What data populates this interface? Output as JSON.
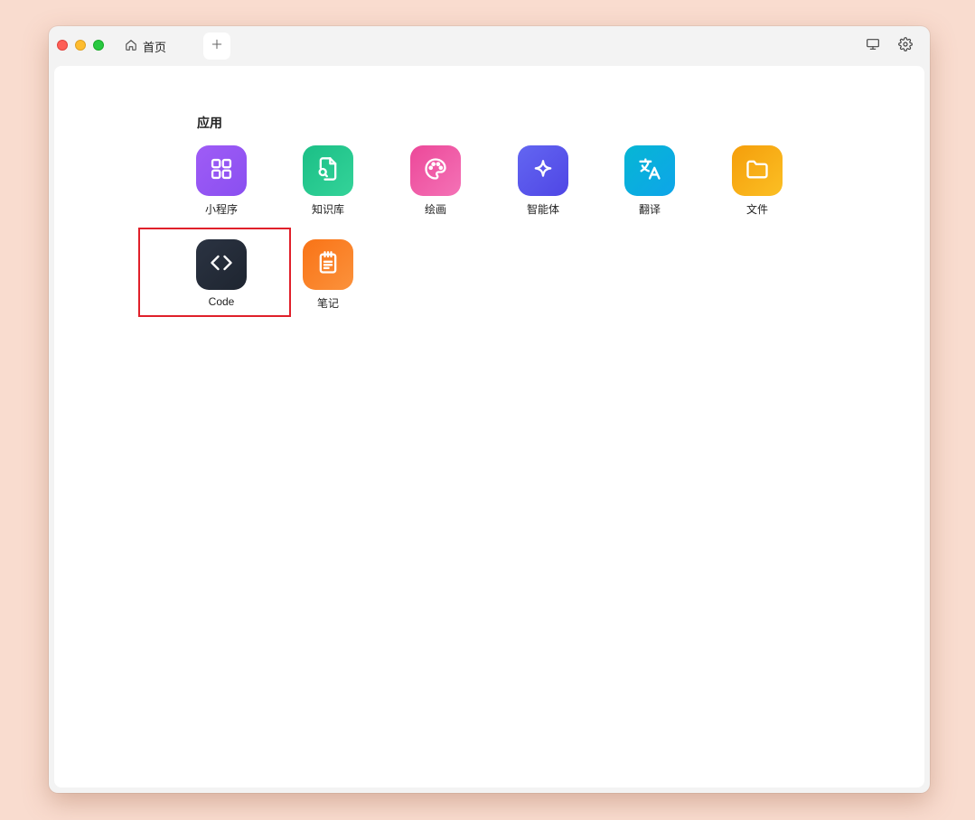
{
  "window": {
    "tab": {
      "label": "首页",
      "icon": "home-icon"
    },
    "add_tab_icon": "plus-icon",
    "toolbar": {
      "screen_icon": "monitor-icon",
      "settings_icon": "gear-icon"
    }
  },
  "section": {
    "title": "应用"
  },
  "apps": [
    {
      "label": "小程序",
      "icon": "grid-icon",
      "color": "#9b59f5"
    },
    {
      "label": "知识库",
      "icon": "file-search-icon",
      "color": "#22c58b"
    },
    {
      "label": "绘画",
      "icon": "palette-icon",
      "color": "#f062a8"
    },
    {
      "label": "智能体",
      "icon": "sparkle-icon",
      "color": "#5b5ef0"
    },
    {
      "label": "翻译",
      "icon": "translate-icon",
      "color": "#0bb0dc"
    },
    {
      "label": "文件",
      "icon": "folder-icon",
      "color": "#f7a814"
    },
    {
      "label": "Code",
      "icon": "code-icon",
      "color": "#262d39"
    },
    {
      "label": "笔记",
      "icon": "notepad-icon",
      "color": "#f97a24"
    }
  ],
  "highlight_color": "#e0202a"
}
